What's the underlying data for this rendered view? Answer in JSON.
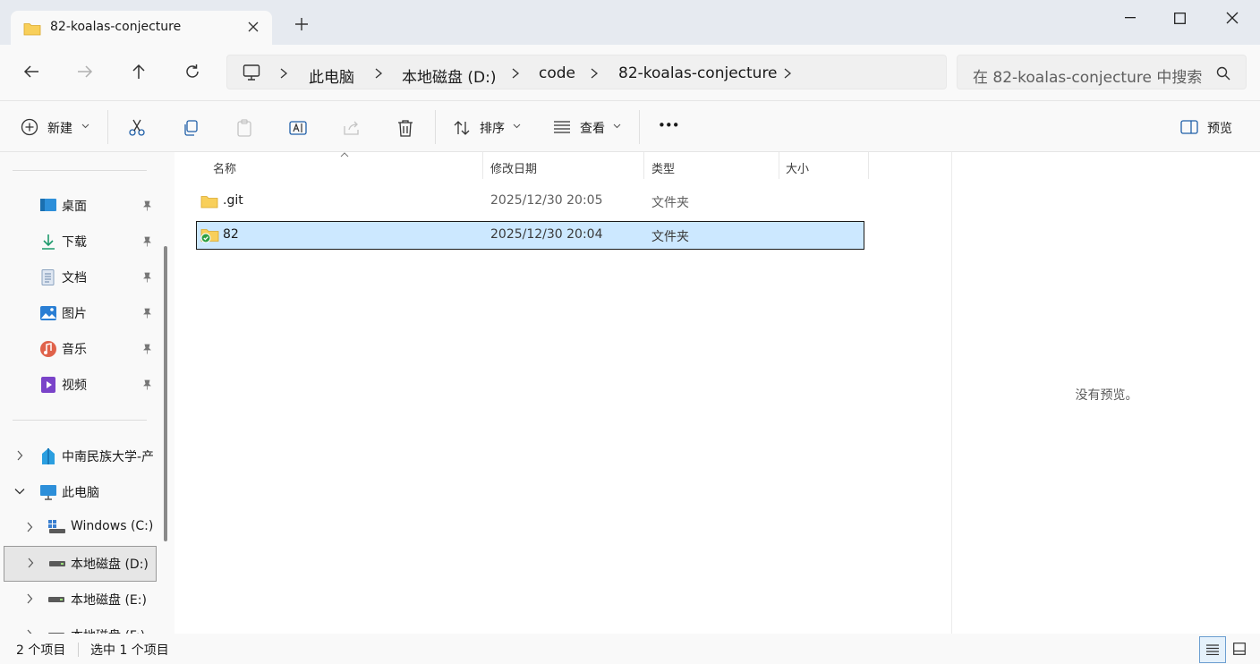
{
  "window": {
    "tab_title": "82-koalas-conjecture",
    "new_tab": "+"
  },
  "address": {
    "crumbs": [
      "此电脑",
      "本地磁盘 (D:)",
      "code",
      "82-koalas-conjecture"
    ],
    "search_placeholder": "在 82-koalas-conjecture 中搜索"
  },
  "toolbar": {
    "new_label": "新建",
    "sort_label": "排序",
    "view_label": "查看",
    "more_label": "•••",
    "preview_label": "预览"
  },
  "sidebar": {
    "quick": [
      {
        "label": "桌面",
        "icon": "desktop-icon"
      },
      {
        "label": "下载",
        "icon": "download-icon"
      },
      {
        "label": "文档",
        "icon": "document-icon"
      },
      {
        "label": "图片",
        "icon": "pictures-icon"
      },
      {
        "label": "音乐",
        "icon": "music-icon"
      },
      {
        "label": "视频",
        "icon": "video-icon"
      }
    ],
    "tree": [
      {
        "label": "中南民族大学-产",
        "icon": "cloud-folder-icon"
      },
      {
        "label": "此电脑",
        "icon": "pc-icon"
      },
      {
        "label": "Windows (C:)",
        "icon": "windows-drive-icon"
      },
      {
        "label": "本地磁盘 (D:)",
        "icon": "drive-icon",
        "selected": true
      },
      {
        "label": "本地磁盘 (E:)",
        "icon": "drive-icon"
      },
      {
        "label": "本地磁盘 (F:)",
        "icon": "drive-icon"
      }
    ]
  },
  "columns": {
    "name": "名称",
    "modified": "修改日期",
    "type": "类型",
    "size": "大小"
  },
  "files": [
    {
      "name": ".git",
      "modified": "2025/12/30 20:05",
      "type": "文件夹",
      "size": "",
      "selected": false
    },
    {
      "name": "82",
      "modified": "2025/12/30 20:04",
      "type": "文件夹",
      "size": "",
      "selected": true
    }
  ],
  "preview": {
    "message": "没有预览。"
  },
  "status": {
    "count": "2 个项目",
    "selection": "选中 1 个项目"
  },
  "colors": {
    "accent": "#0067c0",
    "selection": "#cce8ff",
    "folder": "#f8cf5a"
  }
}
